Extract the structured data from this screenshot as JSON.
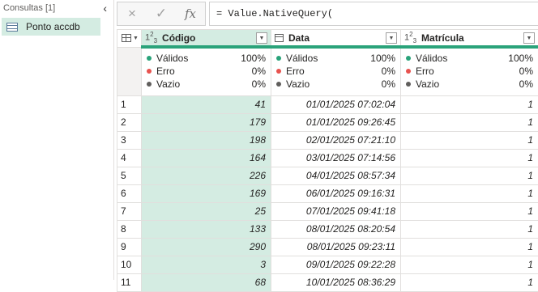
{
  "queries": {
    "header": "Consultas [1]",
    "collapse_icon": "chevron-left-icon",
    "items": [
      {
        "label": "Ponto accdb",
        "icon": "table-icon"
      }
    ]
  },
  "formula_bar": {
    "cancel_icon": "×",
    "commit_icon": "✓",
    "fx_label": "fx",
    "formula": "= Value.NativeQuery("
  },
  "columns": [
    {
      "name": "Código",
      "type_icon": "123",
      "selected": true
    },
    {
      "name": "Data",
      "type_icon": "calendar",
      "selected": false
    },
    {
      "name": "Matrícula",
      "type_icon": "123",
      "selected": false
    }
  ],
  "quality": {
    "labels": [
      "Válidos",
      "Erro",
      "Vazio"
    ],
    "colors": [
      "#2aa37a",
      "#e8534f",
      "#605e5c"
    ],
    "values": [
      [
        "100%",
        "0%",
        "0%"
      ],
      [
        "100%",
        "0%",
        "0%"
      ],
      [
        "100%",
        "0%",
        "0%"
      ]
    ]
  },
  "rows": [
    {
      "n": "1",
      "codigo": "41",
      "data": "01/01/2025 07:02:04",
      "matricula": "1"
    },
    {
      "n": "2",
      "codigo": "179",
      "data": "01/01/2025 09:26:45",
      "matricula": "1"
    },
    {
      "n": "3",
      "codigo": "198",
      "data": "02/01/2025 07:21:10",
      "matricula": "1"
    },
    {
      "n": "4",
      "codigo": "164",
      "data": "03/01/2025 07:14:56",
      "matricula": "1"
    },
    {
      "n": "5",
      "codigo": "226",
      "data": "04/01/2025 08:57:34",
      "matricula": "1"
    },
    {
      "n": "6",
      "codigo": "169",
      "data": "06/01/2025 09:16:31",
      "matricula": "1"
    },
    {
      "n": "7",
      "codigo": "25",
      "data": "07/01/2025 09:41:18",
      "matricula": "1"
    },
    {
      "n": "8",
      "codigo": "133",
      "data": "08/01/2025 08:20:54",
      "matricula": "1"
    },
    {
      "n": "9",
      "codigo": "290",
      "data": "08/01/2025 09:23:11",
      "matricula": "1"
    },
    {
      "n": "10",
      "codigo": "3",
      "data": "09/01/2025 09:22:28",
      "matricula": "1"
    },
    {
      "n": "11",
      "codigo": "68",
      "data": "10/01/2025 08:36:29",
      "matricula": "1"
    }
  ]
}
